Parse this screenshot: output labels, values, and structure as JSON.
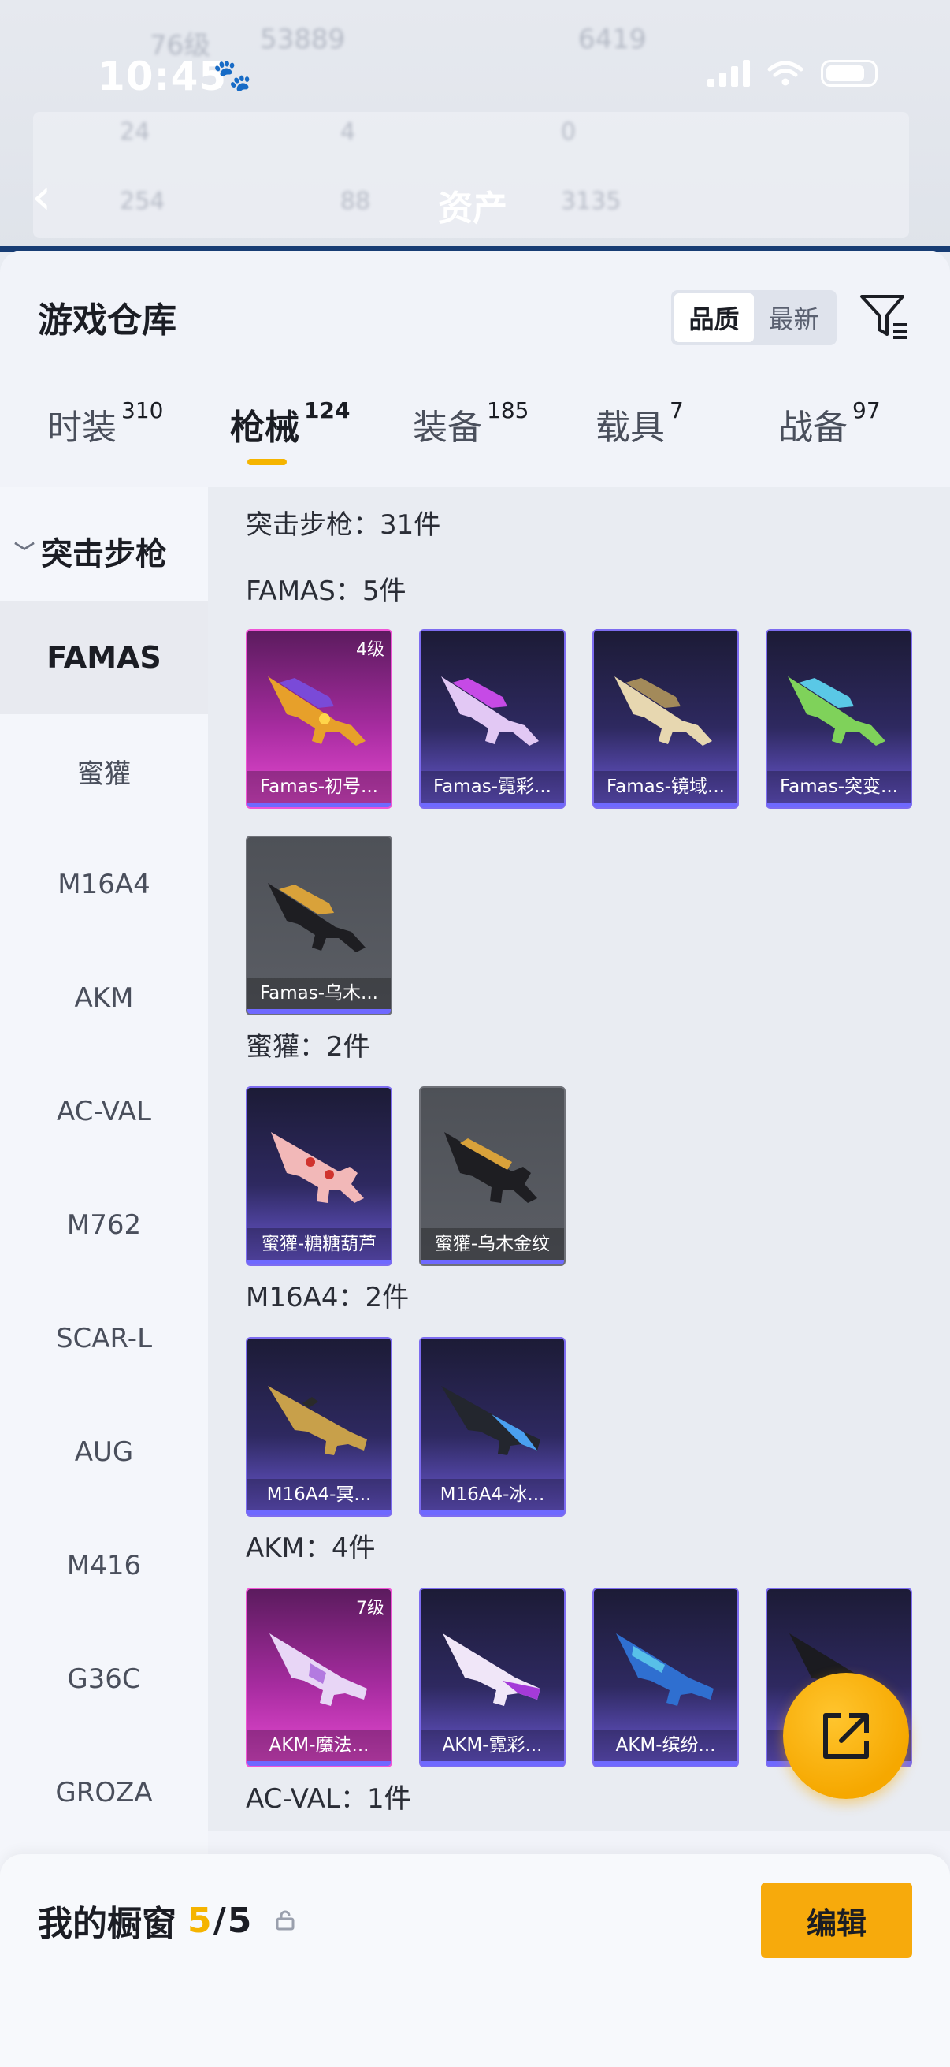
{
  "status_bar": {
    "time": "10:45"
  },
  "background_header": {
    "level": "76级",
    "views": "53889",
    "score": "6419",
    "stat_1": "24",
    "stat_2": "4",
    "stat_3": "0",
    "stat_4": "254",
    "stat_5": "88",
    "stat_6": "3135",
    "title": "资产"
  },
  "sheet": {
    "title": "游戏仓库",
    "sort_options": [
      "品质",
      "最新"
    ],
    "active_sort": "品质"
  },
  "tabs": [
    {
      "label": "时装",
      "count": "310"
    },
    {
      "label": "枪械",
      "count": "124"
    },
    {
      "label": "装备",
      "count": "185"
    },
    {
      "label": "载具",
      "count": "7"
    },
    {
      "label": "战备",
      "count": "97"
    }
  ],
  "sidebar": {
    "group": "突击步枪",
    "items": [
      "FAMAS",
      "蜜獾",
      "M16A4",
      "AKM",
      "AC-VAL",
      "M762",
      "SCAR-L",
      "AUG",
      "M416",
      "G36C",
      "GROZA"
    ]
  },
  "content": {
    "summary": "突击步枪：31件",
    "sections": [
      {
        "title": "FAMAS：5件",
        "items": [
          {
            "name": "Famas-初号...",
            "level": "4级",
            "rarity": "pink"
          },
          {
            "name": "Famas-霓彩...",
            "level": "",
            "rarity": "purple"
          },
          {
            "name": "Famas-镜域...",
            "level": "",
            "rarity": "purple"
          },
          {
            "name": "Famas-突变...",
            "level": "",
            "rarity": "purple"
          },
          {
            "name": "Famas-乌木...",
            "level": "",
            "rarity": "gray"
          }
        ]
      },
      {
        "title": "蜜獾：2件",
        "items": [
          {
            "name": "蜜獾-糖糖葫芦",
            "level": "",
            "rarity": "purple"
          },
          {
            "name": "蜜獾-乌木金纹",
            "level": "",
            "rarity": "gray"
          }
        ]
      },
      {
        "title": "M16A4：2件",
        "items": [
          {
            "name": "M16A4-冥...",
            "level": "",
            "rarity": "purple"
          },
          {
            "name": "M16A4-冰...",
            "level": "",
            "rarity": "purple"
          }
        ]
      },
      {
        "title": "AKM：4件",
        "items": [
          {
            "name": "AKM-魔法...",
            "level": "7级",
            "rarity": "pink"
          },
          {
            "name": "AKM-霓彩...",
            "level": "",
            "rarity": "purple"
          },
          {
            "name": "AKM-缤纷...",
            "level": "",
            "rarity": "purple"
          },
          {
            "name": "",
            "level": "",
            "rarity": "purple"
          }
        ]
      },
      {
        "title": "AC-VAL：1件",
        "items": []
      }
    ]
  },
  "showcase": {
    "label": "我的橱窗",
    "current": "5",
    "total": "5",
    "edit_label": "编辑"
  }
}
